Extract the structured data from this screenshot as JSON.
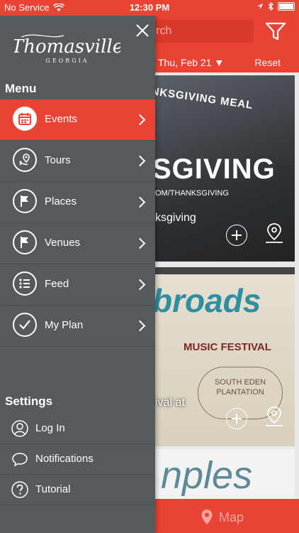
{
  "status_bar": {
    "carrier": "No Service",
    "time": "12:30 PM"
  },
  "app_header": {
    "search_placeholder": "rch",
    "date_filter": "Thu, Feb 21",
    "reset_label": "Reset"
  },
  "feed": {
    "card1": {
      "banner_text": "NKSGIVING MEAL",
      "big_text": "SGIVING",
      "sub_text": "OM/THANKSGIVING",
      "title": "ksgiving"
    },
    "card2": {
      "big_text": "broads",
      "sub_text": "MUSIC FESTIVAL",
      "badge_text": "SOUTH EDEN PLANTATION",
      "title": "ival at"
    },
    "card3": {
      "big_text": "nples"
    }
  },
  "map_bar": {
    "label": "Map"
  },
  "drawer": {
    "logo_text": "Thomasville",
    "logo_subtext": "GEORGIA",
    "menu_heading": "Menu",
    "menu_items": [
      {
        "label": "Events",
        "icon": "calendar-icon",
        "active": true
      },
      {
        "label": "Tours",
        "icon": "map-pin-route-icon",
        "active": false
      },
      {
        "label": "Places",
        "icon": "flag-icon",
        "active": false
      },
      {
        "label": "Venues",
        "icon": "flag-icon",
        "active": false
      },
      {
        "label": "Feed",
        "icon": "list-icon",
        "active": false
      },
      {
        "label": "My Plan",
        "icon": "checkmark-icon",
        "active": false
      }
    ],
    "settings_heading": "Settings",
    "settings_items": [
      {
        "label": "Log In",
        "icon": "user-icon"
      },
      {
        "label": "Notifications",
        "icon": "speech-bubble-icon"
      },
      {
        "label": "Tutorial",
        "icon": "question-icon"
      }
    ]
  },
  "colors": {
    "accent": "#e94335",
    "drawer_bg": "#555a5c"
  }
}
